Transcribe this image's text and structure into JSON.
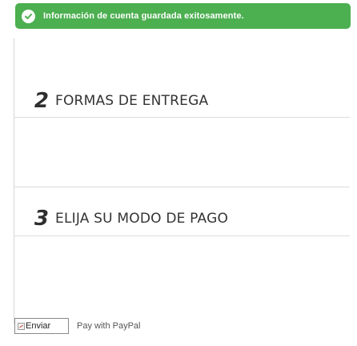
{
  "alert": {
    "icon": "check-circle-icon",
    "message": "Información de cuenta guardada exitosamente.",
    "color": "#4caf50"
  },
  "steps": [
    {
      "number": "2",
      "title": "FORMAS DE ENTREGA"
    },
    {
      "number": "3",
      "title": "ELIJA SU MODO DE PAGO"
    }
  ],
  "payment": {
    "button_alt": "Enviar",
    "button_icon": "broken-image-icon",
    "method_label": "Pay with PayPal"
  }
}
